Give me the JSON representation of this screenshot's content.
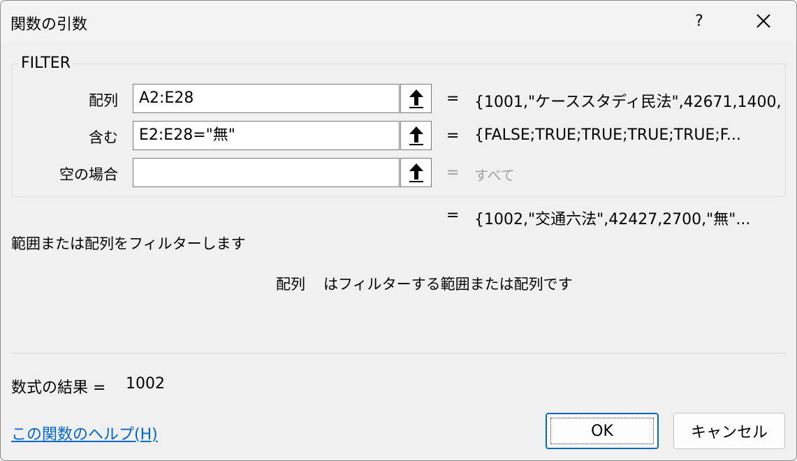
{
  "window": {
    "title": "関数の引数",
    "help_label": "?"
  },
  "function": {
    "name": "FILTER",
    "args": [
      {
        "label": "配列",
        "value": "A2:E28",
        "placeholder": "",
        "result": "{1001,\"ケーススタディ民法\",42671,1400,",
        "result_muted": false
      },
      {
        "label": "含む",
        "value": "E2:E28=\"無\"",
        "placeholder": "",
        "result": "{FALSE;TRUE;TRUE;TRUE;TRUE;F...",
        "result_muted": false
      },
      {
        "label": "空の場合",
        "value": "",
        "placeholder": "",
        "result": "すべて",
        "result_muted": true
      }
    ],
    "equals": "=",
    "overall_result": "{1002,\"交通六法\",42427,2700,\"無\"..."
  },
  "description": {
    "main": "範囲または配列をフィルターします",
    "arg_name": "配列",
    "arg_text": "はフィルターする範囲または配列です"
  },
  "result": {
    "label": "数式の結果 =",
    "value": "1002"
  },
  "footer": {
    "help_link": "この関数のヘルプ(H)",
    "ok_label": "OK",
    "cancel_label": "キャンセル"
  },
  "icons": {
    "close": "close-icon",
    "collapse": "collapse-dialog-arrow-icon"
  }
}
